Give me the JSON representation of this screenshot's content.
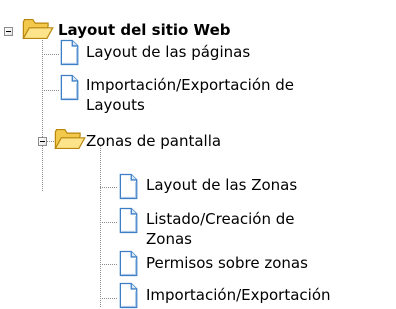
{
  "tree": {
    "root": {
      "label": "Layout del sitio Web",
      "children": [
        {
          "label": "Layout de las páginas"
        },
        {
          "label_line1": "Importación/Exportación de",
          "label_line2": "Layouts"
        },
        {
          "label": "Zonas de pantalla",
          "children": [
            {
              "label": "Layout de las Zonas"
            },
            {
              "label_line1": "Listado/Creación de",
              "label_line2": "Zonas"
            },
            {
              "label": "Permisos sobre zonas"
            },
            {
              "label": "Importación/Exportación"
            }
          ]
        }
      ]
    }
  },
  "colors": {
    "folder": "#f7d66b",
    "folder_edge": "#c89a1c",
    "document_page": "#ffffff",
    "document_edge": "#3d7fc6",
    "tree_lines": "#8c8c8c"
  },
  "icons": {
    "folder": "open-folder-icon",
    "document": "document-icon",
    "collapse": "collapse-minus-icon"
  }
}
